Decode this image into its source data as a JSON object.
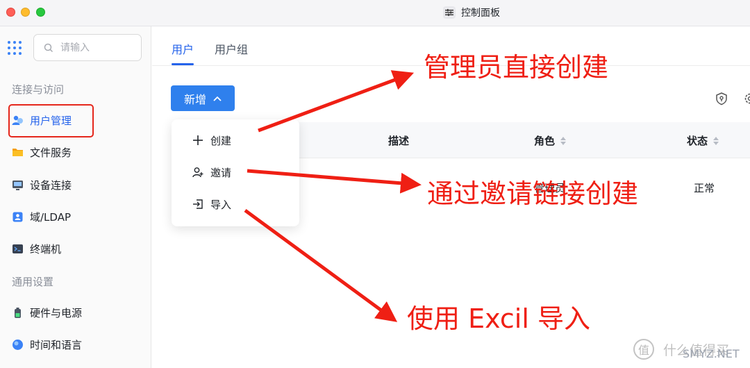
{
  "window": {
    "title": "控制面板"
  },
  "sidebar": {
    "search_placeholder": "请输入",
    "section1": "连接与访问",
    "section2": "通用设置",
    "items": [
      {
        "label": "用户管理",
        "icon": "user-group-icon"
      },
      {
        "label": "文件服务",
        "icon": "folder-icon"
      },
      {
        "label": "设备连接",
        "icon": "device-icon"
      },
      {
        "label": "域/LDAP",
        "icon": "id-card-icon"
      },
      {
        "label": "终端机",
        "icon": "terminal-icon"
      },
      {
        "label": "硬件与电源",
        "icon": "battery-icon"
      },
      {
        "label": "时间和语言",
        "icon": "globe-icon"
      }
    ]
  },
  "tabs": [
    {
      "label": "用户"
    },
    {
      "label": "用户组"
    }
  ],
  "toolbar": {
    "add_label": "新增"
  },
  "dropdown": {
    "items": [
      {
        "label": "创建",
        "icon": "plus-icon"
      },
      {
        "label": "邀请",
        "icon": "user-add-icon"
      },
      {
        "label": "导入",
        "icon": "import-icon"
      }
    ]
  },
  "table": {
    "headers": {
      "desc": "描述",
      "role": "角色",
      "status": "状态"
    },
    "row": {
      "role": "管理员",
      "status": "正常"
    }
  },
  "annotations": {
    "a1": "管理员直接创建",
    "a2": "通过邀请链接创建",
    "a3": "使用 Excil 导入"
  },
  "colors": {
    "accent": "#2f80ed",
    "annotation": "#ef1f14"
  },
  "watermark": {
    "text": "什么值得买",
    "url": "SMYZ.NET"
  }
}
